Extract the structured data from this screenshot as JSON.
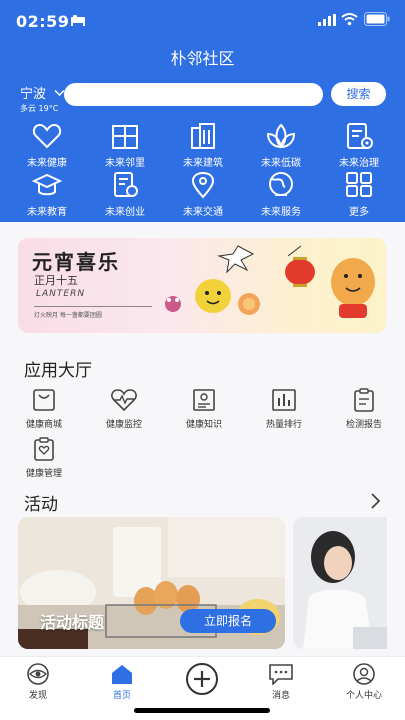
{
  "status_bar": {
    "time": "02:59"
  },
  "header": {
    "title": "朴邻社区"
  },
  "location": {
    "city": "宁波",
    "weather": "多云 19°C"
  },
  "search": {
    "placeholder": "",
    "button_label": "搜索"
  },
  "services": [
    {
      "label": "未来健康",
      "icon": "heart-icon"
    },
    {
      "label": "未来邻里",
      "icon": "building-icon"
    },
    {
      "label": "未来建筑",
      "icon": "architecture-icon"
    },
    {
      "label": "未来低碳",
      "icon": "leaf-icon"
    },
    {
      "label": "未来治理",
      "icon": "governance-icon"
    },
    {
      "label": "未来教育",
      "icon": "graduation-cap-icon"
    },
    {
      "label": "未来创业",
      "icon": "startup-doc-icon"
    },
    {
      "label": "未来交通",
      "icon": "location-pin-icon"
    },
    {
      "label": "未来服务",
      "icon": "globe-icon"
    },
    {
      "label": "更多",
      "icon": "grid-icon"
    }
  ],
  "banner": {
    "title": "元宵喜乐",
    "subtitle": "正月十五",
    "english": "LANTERN",
    "small_text": "灯火映月 每一盏都要团圆"
  },
  "app_hall": {
    "title": "应用大厅",
    "apps": [
      {
        "label": "健康商城",
        "icon": "shopping-bag-icon"
      },
      {
        "label": "健康监控",
        "icon": "heart-monitor-icon"
      },
      {
        "label": "健康知识",
        "icon": "knowledge-icon"
      },
      {
        "label": "热量排行",
        "icon": "bar-chart-icon"
      },
      {
        "label": "检测报告",
        "icon": "report-icon"
      },
      {
        "label": "健康管理",
        "icon": "health-management-icon"
      }
    ]
  },
  "activities": {
    "title": "活动",
    "card_title": "活动标题",
    "signup_label": "立即报名"
  },
  "tabbar": {
    "items": [
      {
        "label": "发现",
        "icon": "eye-icon"
      },
      {
        "label": "首页",
        "icon": "home-icon",
        "active": true
      },
      {
        "label": "",
        "icon": "plus-circle-icon"
      },
      {
        "label": "消息",
        "icon": "message-icon"
      },
      {
        "label": "个人中心",
        "icon": "user-icon"
      }
    ]
  },
  "colors": {
    "primary": "#2f6fe4",
    "background": "#f7f7f9"
  }
}
